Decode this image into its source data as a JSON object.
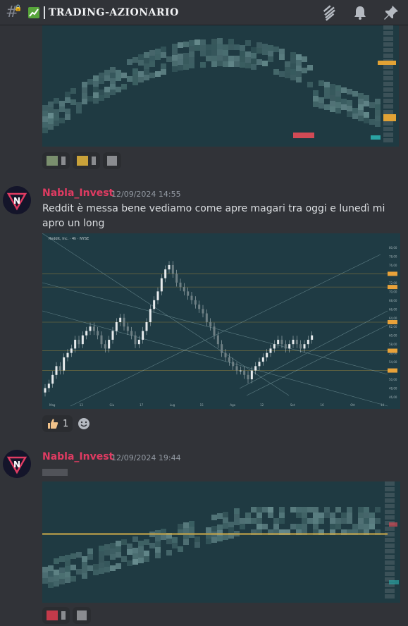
{
  "header": {
    "channel_name": "TRADING-AZIONARIO",
    "icons": [
      "threads-icon",
      "bell-icon",
      "pin-icon"
    ]
  },
  "messages": [
    {
      "author": "Nabla_Invest",
      "timestamp": "12/09/2024 14:55",
      "text": "Reddit è messa bene vediamo come apre magari tra oggi e lunedì mi apro un long",
      "chart_header": "Reddit, Inc. · 4h · NYSE",
      "x_labels": [
        "Mag",
        "13",
        "Giu",
        "17",
        "Lug",
        "15",
        "Ago",
        "12",
        "Set",
        "16",
        "Ott",
        "14"
      ],
      "y_labels": [
        "80,00",
        "78,00",
        "76,00",
        "74,00",
        "72,00",
        "70,00",
        "68,00",
        "66,00",
        "64,00",
        "62,00",
        "60,00",
        "58,00",
        "56,00",
        "54,00",
        "52,00",
        "50,00",
        "48,00",
        "46,00"
      ],
      "reactions": [
        {
          "emoji": "thumbs-up",
          "count": "1"
        }
      ]
    },
    {
      "author": "Nabla_Invest",
      "timestamp": "12/09/2024 19:44"
    }
  ],
  "colors": {
    "username": "#e03b62",
    "background": "#313338",
    "chart_bg": "#1f3a42"
  }
}
